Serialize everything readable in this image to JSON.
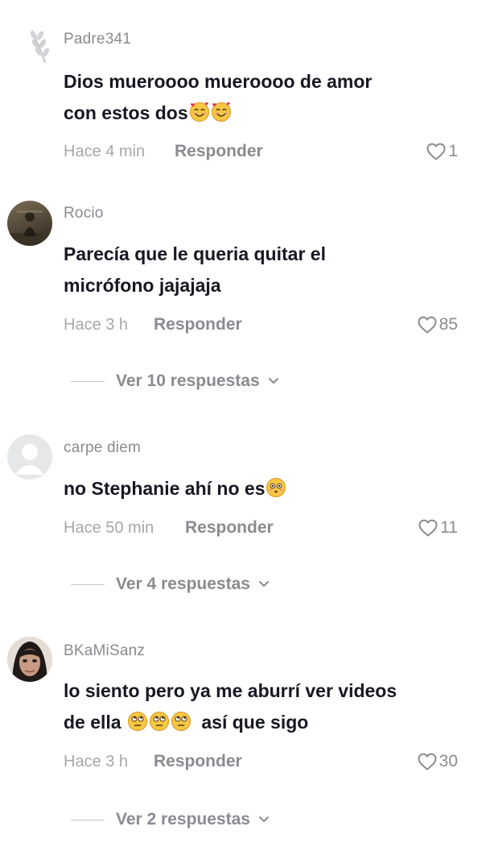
{
  "comments": [
    {
      "username": "Padre341",
      "lines": [
        "Dios mueroooo mueroooo de amor",
        "con estos dos"
      ],
      "time": "Hace 4 min",
      "reply_label": "Responder",
      "likes": "1"
    },
    {
      "username": "Rocio",
      "lines": [
        "Parecía que le queria quitar el",
        "micrófono jajajaja"
      ],
      "time": "Hace 3 h",
      "reply_label": "Responder",
      "likes": "85",
      "replies_label": "Ver 10 respuestas"
    },
    {
      "username": "carpe diem",
      "lines": [
        "no Stephanie ahí no es"
      ],
      "time": "Hace 50 min",
      "reply_label": "Responder",
      "likes": "11",
      "replies_label": "Ver 4 respuestas"
    },
    {
      "username": "BKaMiSanz",
      "lines": [
        "lo siento pero ya me aburrí ver videos",
        "de ella",
        "así que sigo"
      ],
      "time": "Hace 3 h",
      "reply_label": "Responder",
      "likes": "30",
      "replies_label": "Ver 2 respuestas"
    }
  ],
  "icons": {
    "like": "heart-outline-icon",
    "expand": "chevron-down-icon",
    "emoji_love": "smiling-face-with-hearts",
    "emoji_flushed": "flushed-face",
    "emoji_eyeroll": "face-with-rolling-eyes"
  },
  "colors": {
    "text": "#161823",
    "secondary": "#8a8b91",
    "muted": "#a7a8ad",
    "emoji": "#f7c744"
  }
}
